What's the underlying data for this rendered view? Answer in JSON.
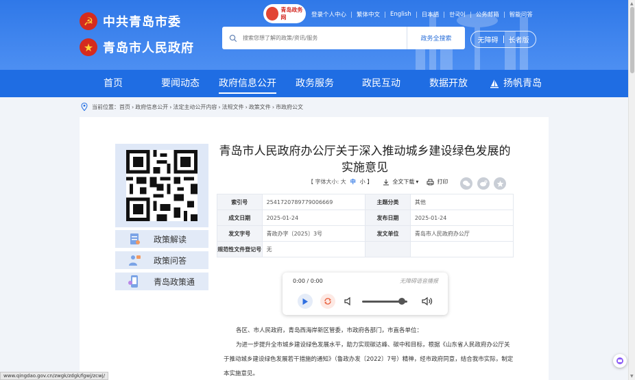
{
  "header": {
    "party_name": "中共青岛市委",
    "gov_name": "青岛市人民政府",
    "portal_logo_text": "青岛政务网",
    "top_links": [
      "登录个人中心",
      "繁体中文",
      "English",
      "日本語",
      "한국어",
      "公务邮箱",
      "智能问答"
    ],
    "search_placeholder": "搜索您想了解的政策/资讯/服务",
    "search_button": "政务全搜索",
    "accessibility": "无障碍",
    "elder_mode": "长者版"
  },
  "nav": {
    "items": [
      "首页",
      "要闻动态",
      "政府信息公开",
      "政务服务",
      "政民互动",
      "数据开放",
      "扬帆青岛"
    ],
    "active": "政府信息公开"
  },
  "breadcrumb": {
    "prefix": "当前位置：",
    "items": [
      "首页",
      "政府信息公开",
      "法定主动公开内容",
      "法规文件",
      "政策文件",
      "市政府公文"
    ],
    "separator": "›"
  },
  "sidebar": {
    "buttons": [
      "政策解读",
      "政策问答",
      "青岛政策通"
    ]
  },
  "article": {
    "title": "青岛市人民政府办公厅关于深入推动城乡建设绿色发展的实施意见",
    "font_size_label": "【 字体大小: 大",
    "font_mid": "中",
    "font_small": "小 】",
    "download": "全文下载",
    "print": "打印",
    "meta": {
      "index_label": "索引号",
      "index_value": "2541720789779006669",
      "category_label": "主题分类",
      "category_value": "其他",
      "date_label": "成文日期",
      "date_value": "2025-01-24",
      "pub_label": "发布日期",
      "pub_value": "2025-01-24",
      "doc_no_label": "发文字号",
      "doc_no_value": "青政办字〔2025〕3号",
      "issuer_label": "发文单位",
      "issuer_value": "青岛市人民政府办公厅",
      "reg_label": "规范性文件登记号",
      "reg_value": "无"
    },
    "audio": {
      "time": "0:00 / 0:00",
      "hint": "无障碍语音播报",
      "volume_level": 0.88
    },
    "paragraphs": [
      "各区、市人民政府，青岛西海岸新区管委，市政府各部门，市直各单位：",
      "为进一步提升全市城乡建设绿色发展水平，助力实现碳达峰、碳中和目标，根据《山东省人民政府办公厅关于推动城乡建设绿色发展若干措施的通知》（鲁政办发〔2022〕7号）精神，经市政府同意，结合我市实际，制定本实施意见。"
    ]
  },
  "status_url": "www.qingdao.gov.cn/zwgk/zdgk/fgwj/zcwj/",
  "colors": {
    "primary": "#1f6de3",
    "header_top": "#2f78e8",
    "party_red": "#d52b1e"
  }
}
